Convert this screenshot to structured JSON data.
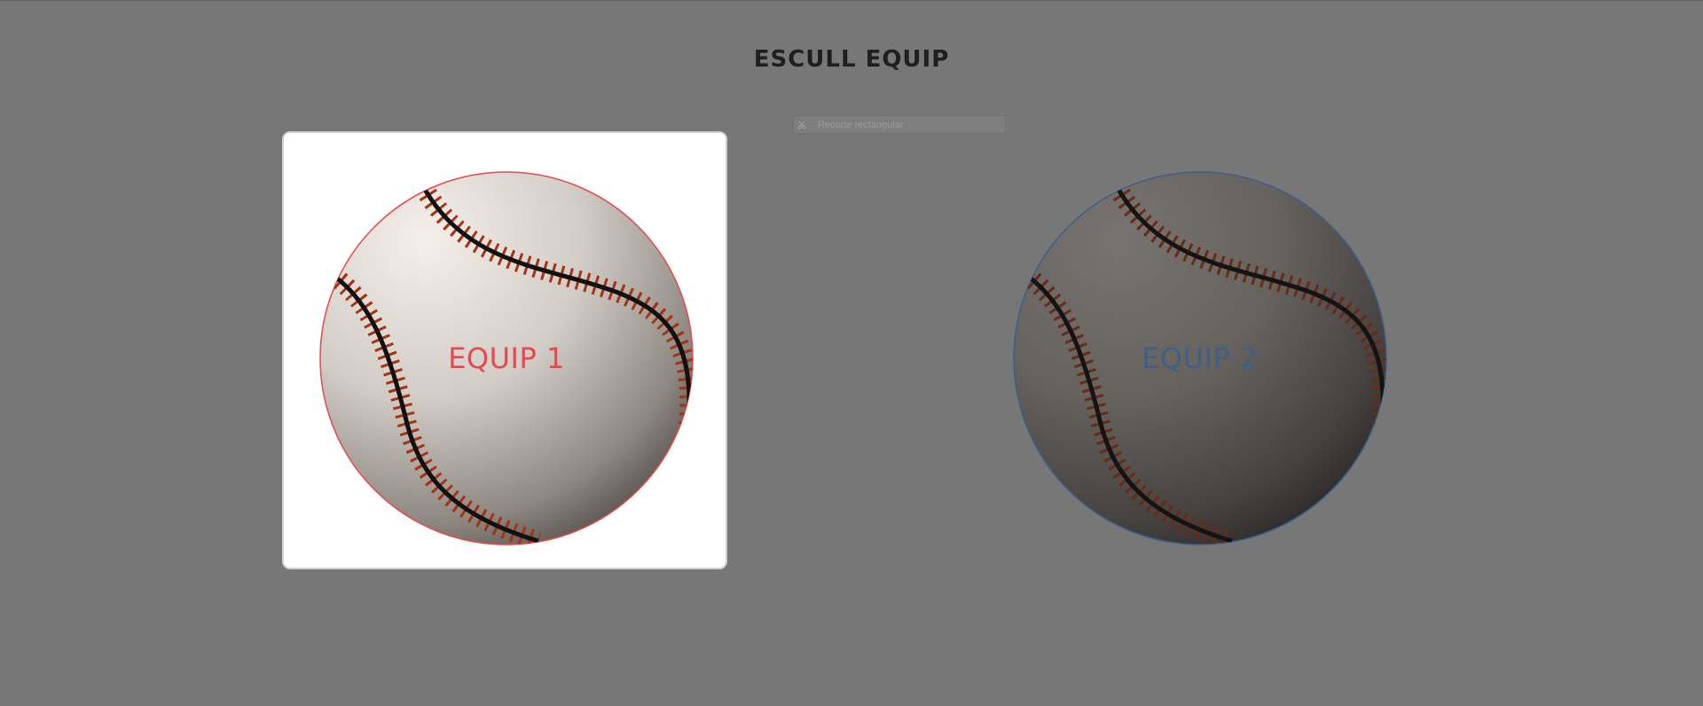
{
  "page": {
    "title": "ESCULL EQUIP"
  },
  "snip_bar": {
    "label": "Recorte rectangular",
    "icon": "scissors-icon"
  },
  "teams": [
    {
      "label": "EQUIP 1",
      "color": "#e8474c",
      "selected": true
    },
    {
      "label": "EQUIP 2",
      "color": "#3d5f8a",
      "selected": false
    }
  ],
  "colors": {
    "background": "#777777",
    "card": "#ffffff",
    "stitch": "#a8320f",
    "seam": "#111111"
  }
}
